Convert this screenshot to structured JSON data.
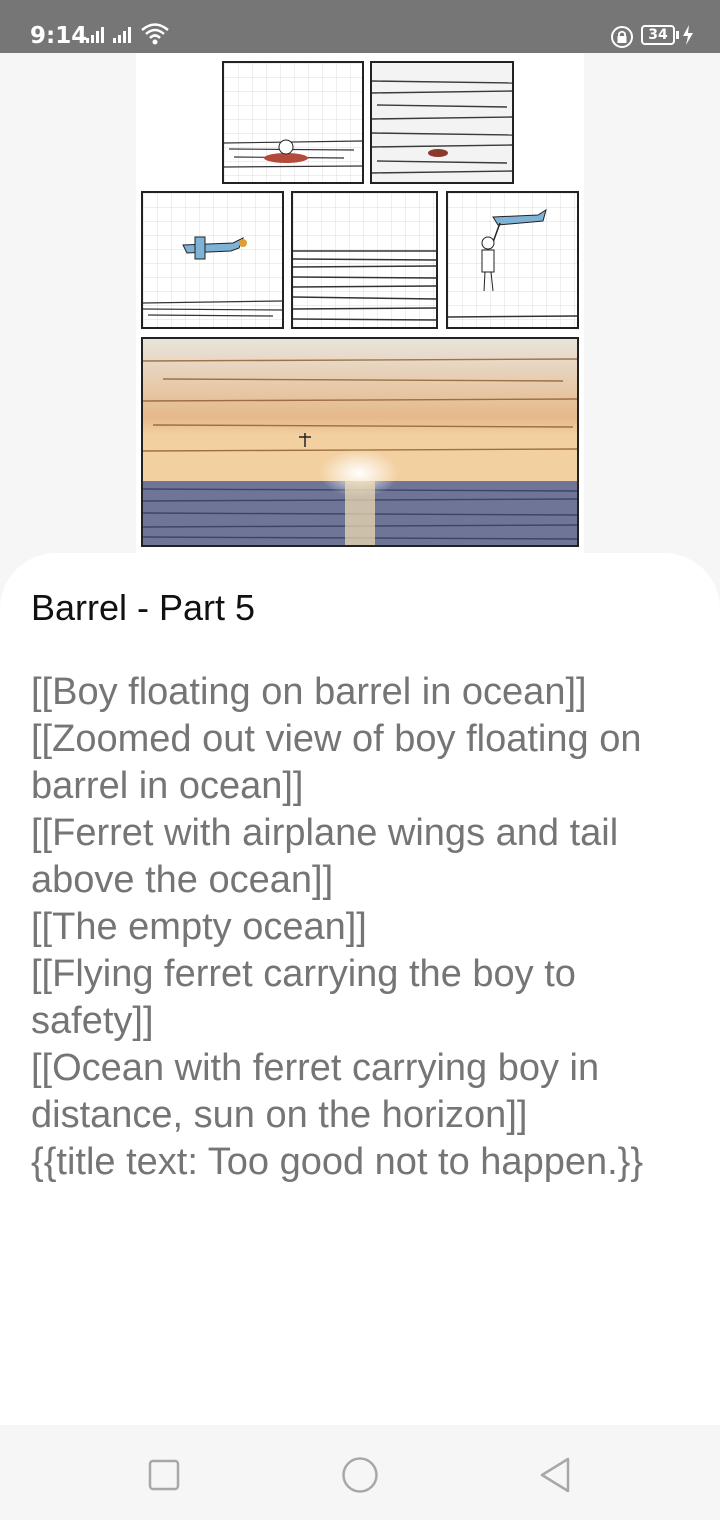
{
  "status_bar": {
    "time": "9:14",
    "battery_level": "34",
    "icons": [
      "signal-icon",
      "signal-icon",
      "wifi-icon",
      "lock-rotation-icon",
      "battery-icon",
      "charging-icon"
    ]
  },
  "comic": {
    "title": "Barrel - Part 5",
    "transcript": [
      "[[Boy floating on barrel in ocean]]",
      "[[Zoomed out view of boy floating on barrel in ocean]]",
      "[[Ferret with airplane wings and tail above the ocean]]",
      "[[The empty ocean]]",
      "[[Flying ferret carrying the boy to safety]]",
      "[[Ocean with ferret carrying boy in distance, sun on the horizon]]",
      "{{title text: Too good not to happen.}}"
    ]
  },
  "nav_bar": {
    "buttons": [
      "recents-square-icon",
      "home-circle-icon",
      "back-triangle-icon"
    ]
  },
  "colors": {
    "status_bar": "#767676",
    "sheet": "#ffffff",
    "title_text": "#111111",
    "transcript_text": "#757575"
  }
}
